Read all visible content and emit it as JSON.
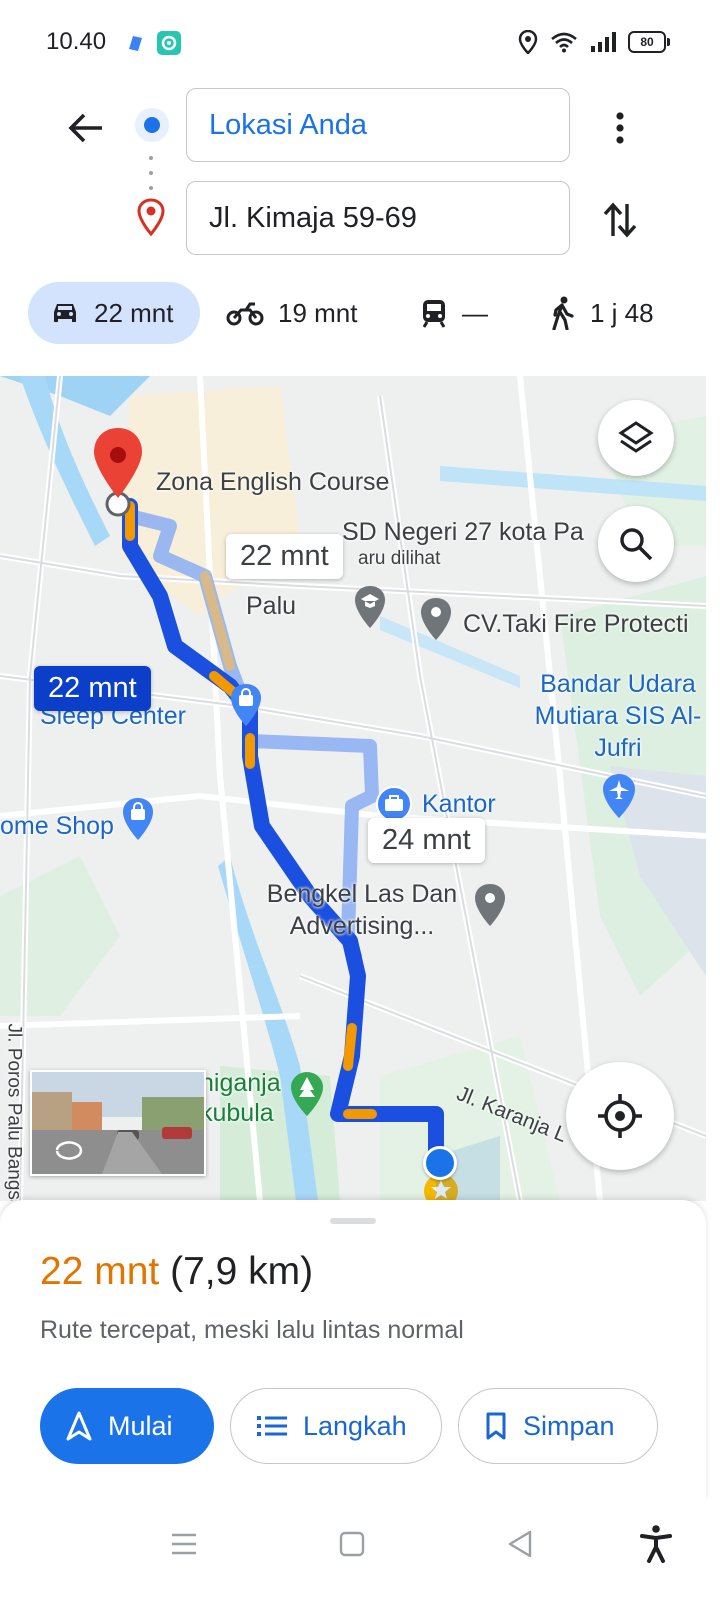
{
  "status_bar": {
    "time": "10.40",
    "battery": "80",
    "icons": [
      "app-blue-icon",
      "app-teal-icon",
      "location-icon",
      "wifi-icon",
      "signal-icon",
      "battery-icon"
    ]
  },
  "search": {
    "origin": "Lokasi Anda",
    "destination": "Jl. Kimaja 59-69"
  },
  "travel_modes": [
    {
      "icon": "car-icon",
      "label": "22 mnt",
      "active": true
    },
    {
      "icon": "motorcycle-icon",
      "label": "19 mnt",
      "active": false
    },
    {
      "icon": "transit-icon",
      "label": "—",
      "active": false
    },
    {
      "icon": "walk-icon",
      "label": "1 j 48",
      "active": false
    }
  ],
  "map": {
    "labels": {
      "zona": "Zona English Course",
      "sd": "SD Negeri 27 kota Pa",
      "baru": "aru dilihat",
      "palu": "Palu",
      "cvtaki": "CV.Taki Fire Protecti",
      "bandara": "Bandar Udara Mutiara SIS Al-Jufri",
      "sleep": "Sleep Center",
      "kantor": "Kantor",
      "homeshop": "ome Shop",
      "bengkel": "Bengkel Las Dan Advertising...",
      "hutan": "niganja kubula",
      "karanja": "Jl. Karanja L",
      "poros": "Jl. Poros Palu Bangsa"
    },
    "eta_bubbles": {
      "selected": "22 mnt",
      "alt1": "22 mnt",
      "alt2": "24 mnt"
    }
  },
  "summary": {
    "time": "22 mnt",
    "distance": "(7,9 km)",
    "description": "Rute tercepat, meski lalu lintas normal"
  },
  "actions": {
    "start": "Mulai",
    "steps": "Langkah",
    "save": "Simpan"
  },
  "colors": {
    "accent": "#1a73e8",
    "route": "#1a4fe0",
    "traffic": "#f29900",
    "eta_orange": "#e37400"
  }
}
